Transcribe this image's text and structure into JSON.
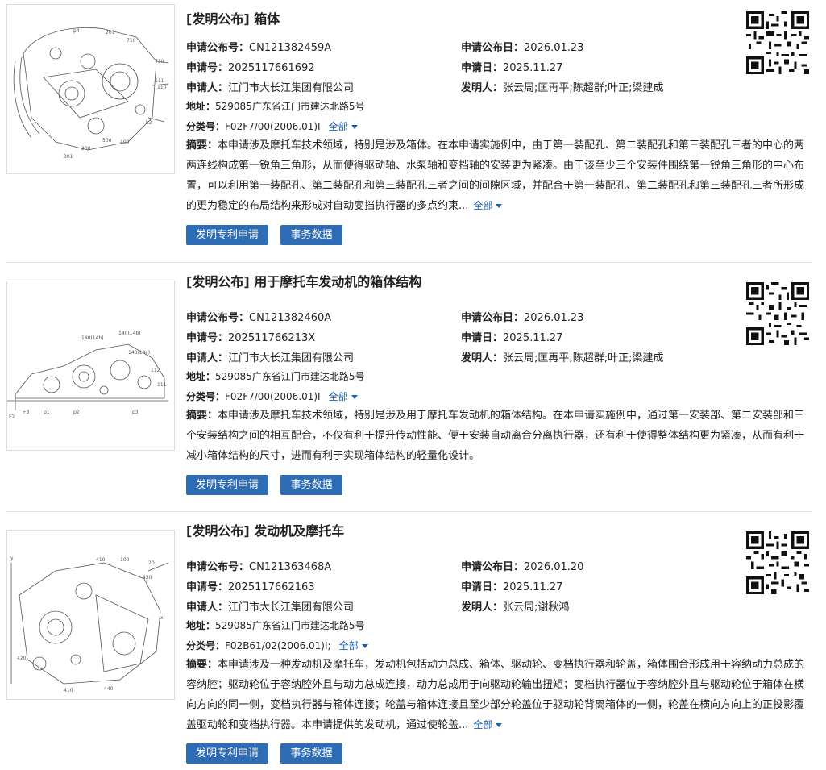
{
  "labels": {
    "pub_no": "申请公布号：",
    "pub_date": "申请公布日：",
    "app_no": "申请号：",
    "app_date": "申请日：",
    "applicant": "申请人：",
    "inventor": "发明人：",
    "address": "地址：",
    "class": "分类号：",
    "abstract": "摘要：",
    "more": "全部",
    "btn_patent": "发明专利申请",
    "btn_affairs": "事务数据"
  },
  "records": [
    {
      "title": "[发明公布] 箱体",
      "pub_no": "CN121382459A",
      "pub_date": "2026.01.23",
      "app_no": "2025117661692",
      "app_date": "2025.11.27",
      "applicant": "江门市大长江集团有限公司",
      "inventor": "张云周;匡再平;陈超群;叶正;梁建成",
      "address": "529085广东省江门市建达北路5号",
      "class": "F02F7/00(2006.01)I",
      "abstract": "本申请涉及摩托车技术领域，特别是涉及箱体。在本申请实施例中，由于第一装配孔、第二装配孔和第三装配孔三者的中心的两两连线构成第一锐角三角形，从而使得驱动轴、水泵轴和变挡轴的安装更为紧凑。由于该至少三个安装件围绕第一锐角三角形的中心布置，可以利用第一装配孔、第二装配孔和第三装配孔三者之间的间隙区域，并配合于第一装配孔、第二装配孔和第三装配孔三者所形成的更为稳定的布局结构来形成对自动变挡执行器的多点约束..."
    },
    {
      "title": "[发明公布] 用于摩托车发动机的箱体结构",
      "pub_no": "CN121382460A",
      "pub_date": "2026.01.23",
      "app_no": "202511766213X",
      "app_date": "2025.11.27",
      "applicant": "江门市大长江集团有限公司",
      "inventor": "张云周;匡再平;陈超群;叶正;梁建成",
      "address": "529085广东省江门市建达北路5号",
      "class": "F02F7/00(2006.01)I",
      "abstract": "本申请涉及摩托车技术领域，特别是涉及用于摩托车发动机的箱体结构。在本申请实施例中，通过第一安装部、第二安装部和三个安装结构之间的相互配合，不仅有利于提升传动性能、便于安装自动离合分离执行器，还有利于使得整体结构更为紧凑，从而有利于减小箱体结构的尺寸，进而有利于实现箱体结构的轻量化设计。"
    },
    {
      "title": "[发明公布] 发动机及摩托车",
      "pub_no": "CN121363468A",
      "pub_date": "2026.01.20",
      "app_no": "2025117662163",
      "app_date": "2025.11.27",
      "applicant": "江门市大长江集团有限公司",
      "inventor": "张云周;谢秋鸿",
      "address": "529085广东省江门市建达北路5号",
      "class": "F02B61/02(2006.01)I;",
      "abstract": "本申请涉及一种发动机及摩托车，发动机包括动力总成、箱体、驱动轮、变档执行器和轮盖，箱体围合形成用于容纳动力总成的容纳腔；驱动轮位于容纳腔外且与动力总成连接，动力总成用于向驱动轮输出扭矩；变档执行器位于容纳腔外且与驱动轮位于箱体在横向方向的同一侧，变档执行器与箱体连接；轮盖与箱体连接且至少部分轮盖位于驱动轮背离箱体的一侧，轮盖在横向方向上的正投影覆盖驱动轮和变档执行器。本申请提供的发动机，通过使轮盖..."
    }
  ]
}
